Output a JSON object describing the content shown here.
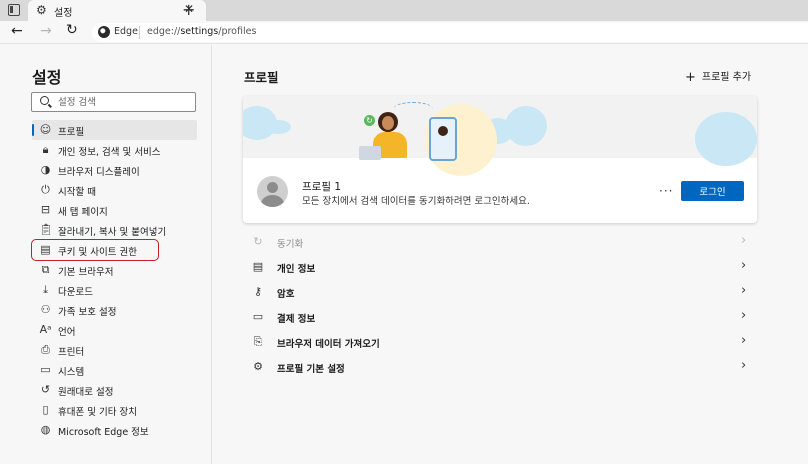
{
  "browser": {
    "tab_title": "설정",
    "address_label": "Edge",
    "url_prefix": "edge://",
    "url_path": "settings",
    "url_suffix": "/profiles"
  },
  "sidebar": {
    "title": "설정",
    "search_placeholder": "설정 검색",
    "items": [
      {
        "label": "프로필",
        "icon": "person-icon"
      },
      {
        "label": "개인 정보, 검색 및 서비스",
        "icon": "lock-icon"
      },
      {
        "label": "브라우저 디스플레이",
        "icon": "palette-icon"
      },
      {
        "label": "시작할 때",
        "icon": "power-icon"
      },
      {
        "label": "새 탭 페이지",
        "icon": "newtab-icon"
      },
      {
        "label": "잘라내기, 복사 및 붙여넣기",
        "icon": "clipboard-icon"
      },
      {
        "label": "쿠키 및 사이트 권한",
        "icon": "cookie-icon"
      },
      {
        "label": "기본 브라우저",
        "icon": "browser-icon"
      },
      {
        "label": "다운로드",
        "icon": "download-icon"
      },
      {
        "label": "가족 보호 설정",
        "icon": "family-icon"
      },
      {
        "label": "언어",
        "icon": "language-icon"
      },
      {
        "label": "프린터",
        "icon": "printer-icon"
      },
      {
        "label": "시스템",
        "icon": "system-icon"
      },
      {
        "label": "원래대로 설정",
        "icon": "reset-icon"
      },
      {
        "label": "휴대폰 및 기타 장치",
        "icon": "phone-icon"
      },
      {
        "label": "Microsoft Edge 정보",
        "icon": "edge-icon"
      }
    ]
  },
  "main": {
    "title": "프로필",
    "add_profile": "프로필 추가",
    "profile": {
      "name": "프로필 1",
      "description": "모든 장치에서 검색 데이터를 동기화하려면 로그인하세요.",
      "more": "···",
      "login_label": "로그인"
    },
    "rows": [
      {
        "label": "동기화",
        "icon": "sync-icon",
        "disabled": true
      },
      {
        "label": "개인 정보",
        "icon": "person-info-icon",
        "disabled": false
      },
      {
        "label": "암호",
        "icon": "key-icon",
        "disabled": false
      },
      {
        "label": "결제 정보",
        "icon": "card-icon",
        "disabled": false
      },
      {
        "label": "브라우저 데이터 가져오기",
        "icon": "import-icon",
        "disabled": false
      },
      {
        "label": "프로필 기본 설정",
        "icon": "profile-settings-icon",
        "disabled": false
      }
    ]
  },
  "colors": {
    "accent": "#0067c0",
    "highlight_outline": "#c0202a"
  }
}
